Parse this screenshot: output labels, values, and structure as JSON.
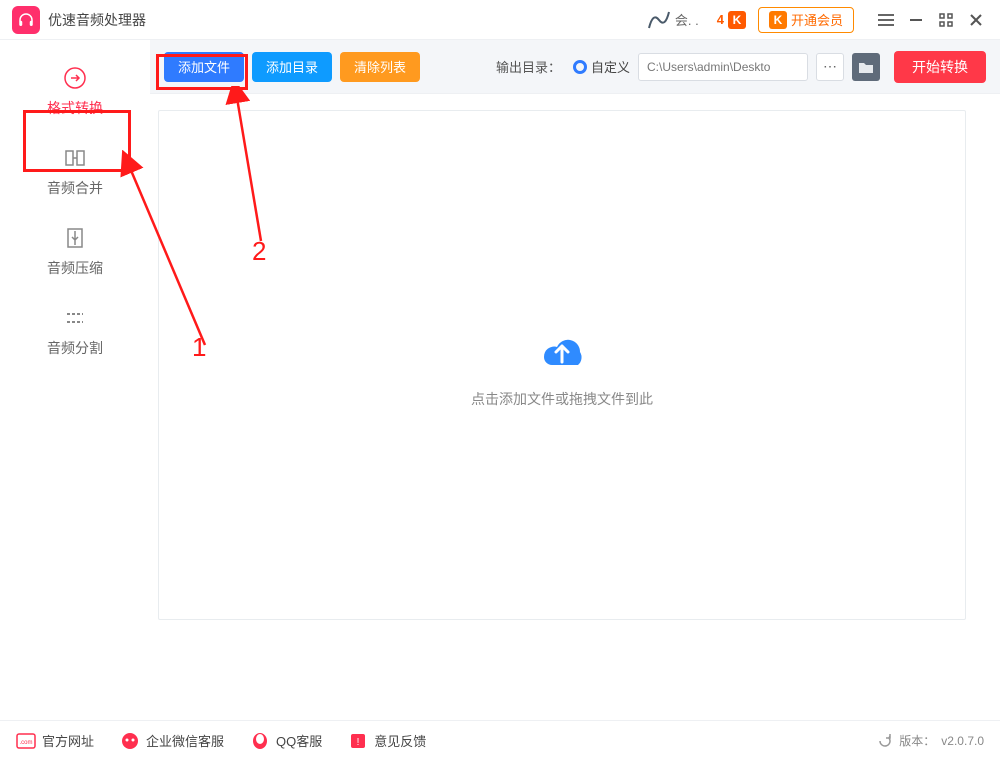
{
  "title": "优速音频处理器",
  "titlebar": {
    "user_text": "会. .",
    "k_num": "4",
    "vip_label": "开通会员"
  },
  "sidebar": {
    "items": [
      {
        "label": "格式转换",
        "name": "sidebar-item-format-convert",
        "active": true
      },
      {
        "label": "音频合并",
        "name": "sidebar-item-audio-merge",
        "active": false
      },
      {
        "label": "音频压缩",
        "name": "sidebar-item-audio-compress",
        "active": false
      },
      {
        "label": "音频分割",
        "name": "sidebar-item-audio-split",
        "active": false
      }
    ]
  },
  "toolbar": {
    "add_file": "添加文件",
    "add_folder": "添加目录",
    "clear_list": "清除列表",
    "output_label": "输出目录：",
    "radio_label": "自定义",
    "path_value": "C:\\Users\\admin\\Deskto",
    "start_label": "开始转换"
  },
  "stage": {
    "drop_text": "点击添加文件或拖拽文件到此"
  },
  "footer": {
    "links": [
      {
        "label": "官方网址",
        "name": "footer-link-website"
      },
      {
        "label": "企业微信客服",
        "name": "footer-link-wechat"
      },
      {
        "label": "QQ客服",
        "name": "footer-link-qq"
      },
      {
        "label": "意见反馈",
        "name": "footer-link-feedback"
      }
    ],
    "version_label": "版本：",
    "version": "v2.0.7.0"
  },
  "annotations": {
    "label1": "1",
    "label2": "2"
  }
}
